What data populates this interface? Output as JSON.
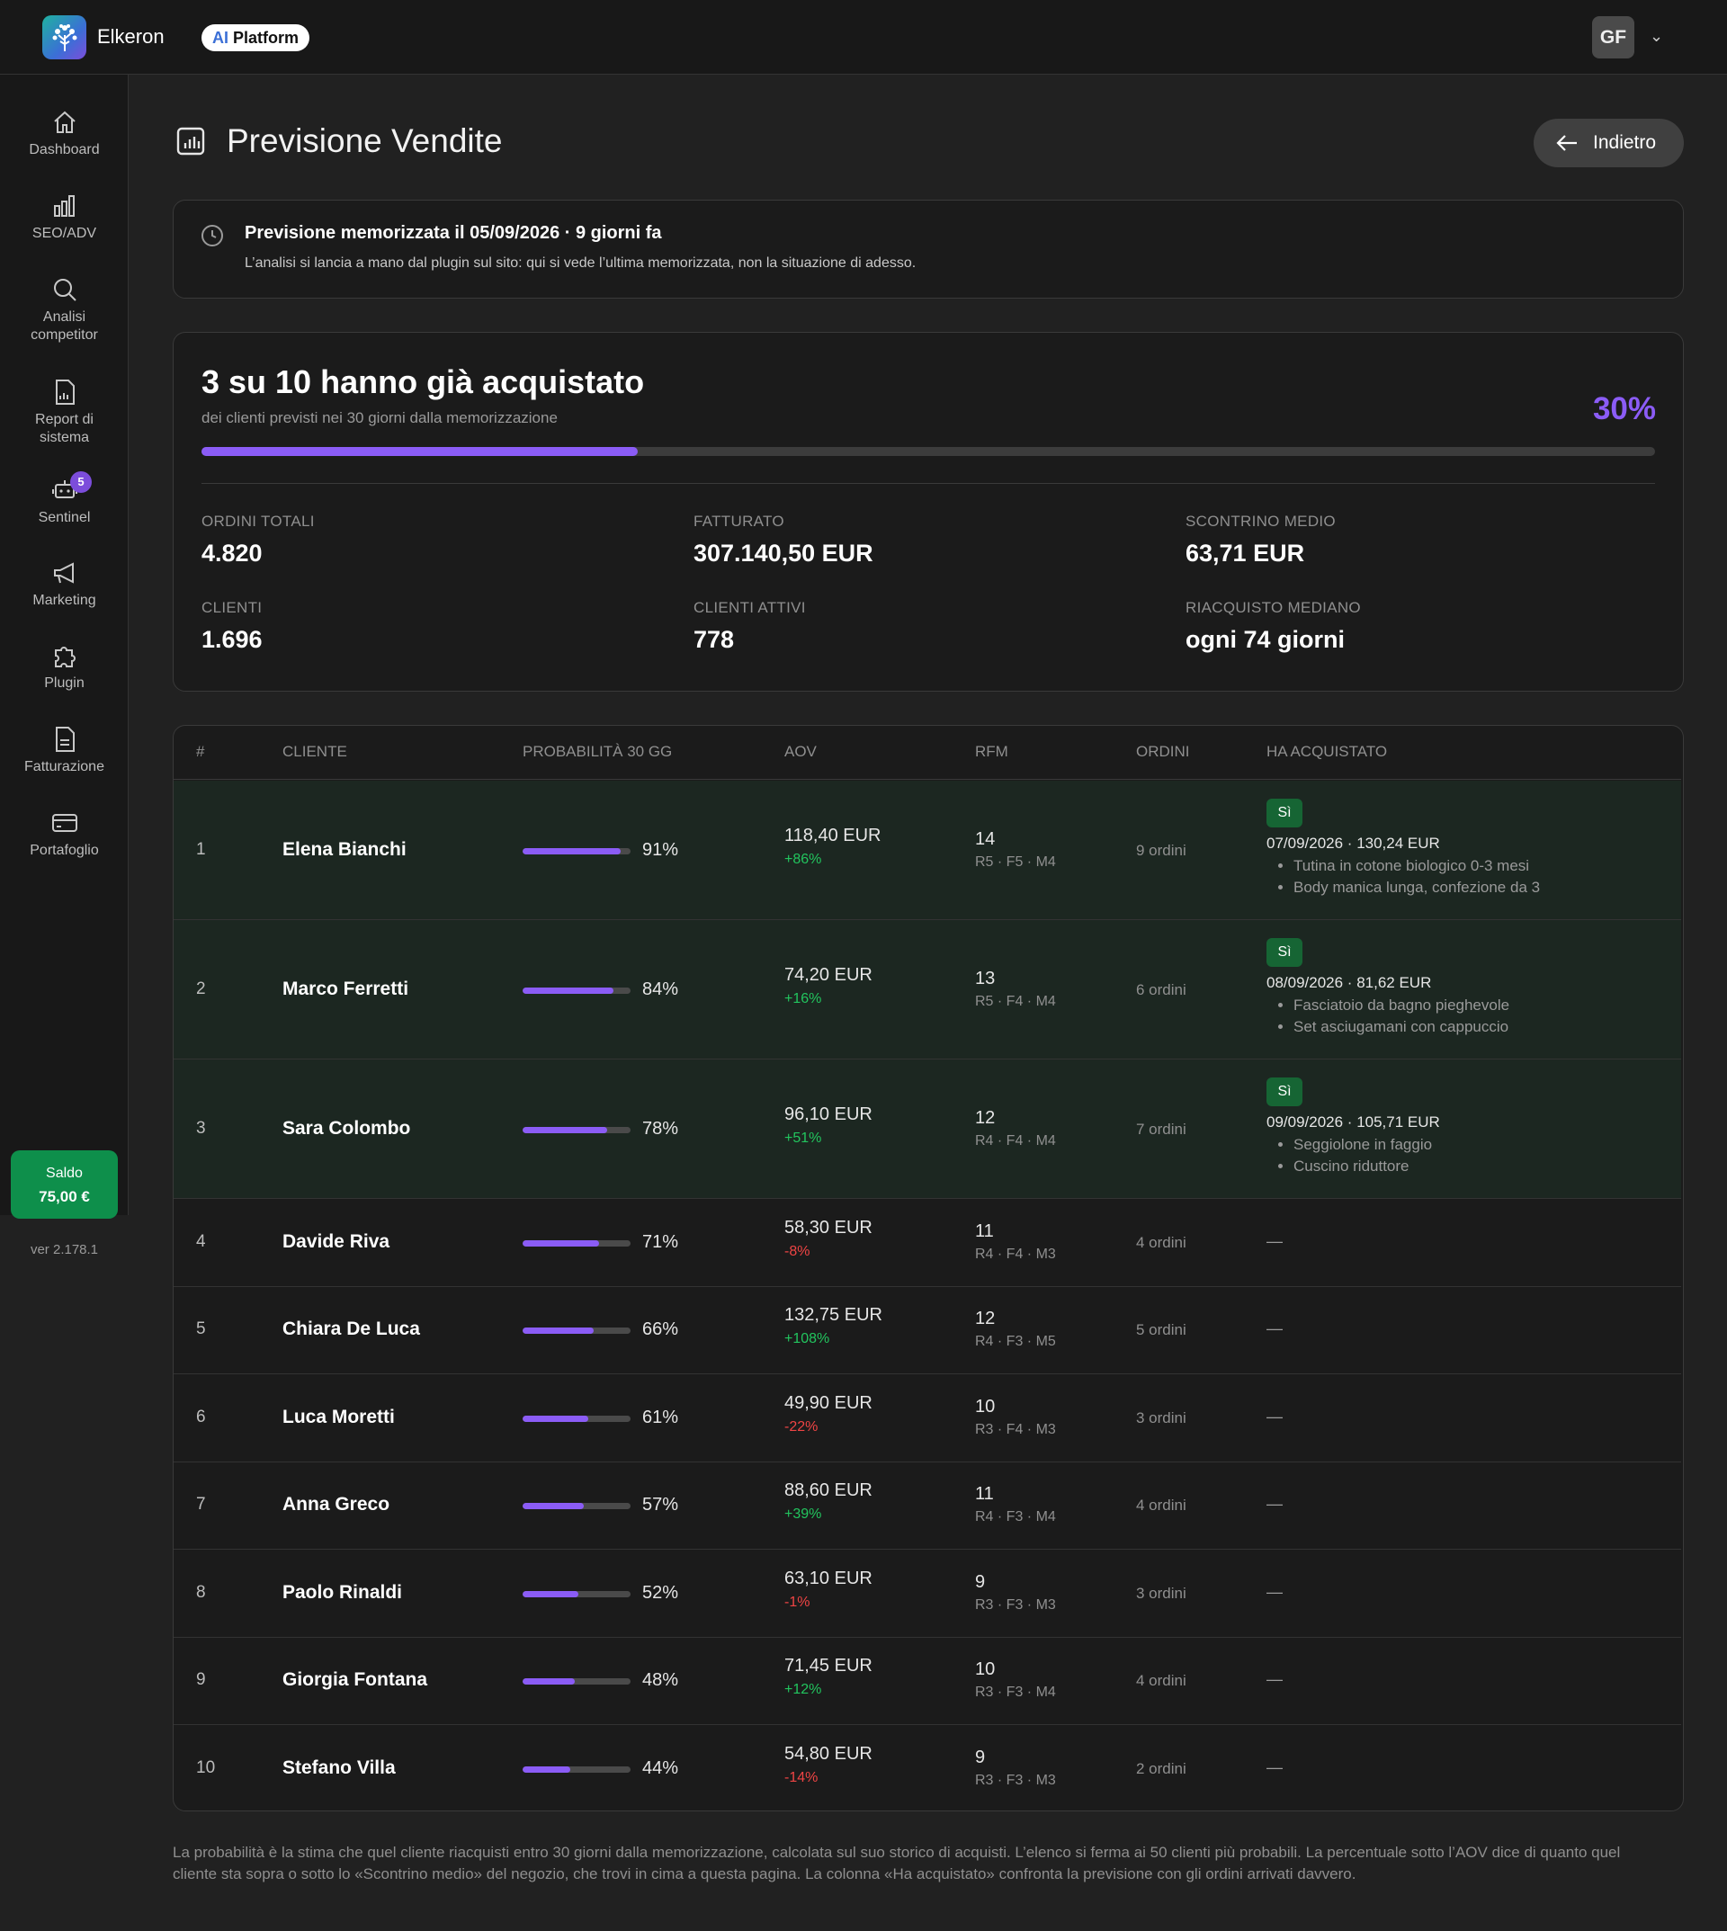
{
  "header": {
    "brand": "Elkeron",
    "ai_pill_ai": "AI",
    "ai_pill_text": "Platform",
    "avatar": "GF"
  },
  "sidebar": {
    "items": [
      {
        "label": "Dashboard",
        "icon": "home-icon"
      },
      {
        "label": "SEO/ADV",
        "icon": "bar-chart-icon"
      },
      {
        "label": "Analisi competitor",
        "icon": "search-icon"
      },
      {
        "label": "Report di sistema",
        "icon": "report-icon"
      },
      {
        "label": "Sentinel",
        "icon": "robot-icon",
        "badge": "5"
      },
      {
        "label": "Marketing",
        "icon": "megaphone-icon"
      },
      {
        "label": "Plugin",
        "icon": "puzzle-icon"
      },
      {
        "label": "Fatturazione",
        "icon": "invoice-icon"
      },
      {
        "label": "Portafoglio",
        "icon": "wallet-icon"
      }
    ],
    "saldo_label": "Saldo",
    "saldo_value": "75,00 €",
    "version": "ver 2.178.1"
  },
  "page": {
    "title": "Previsione Vendite",
    "back_label": "Indietro"
  },
  "info": {
    "title": "Previsione memorizzata il 05/09/2026 · 9 giorni fa",
    "text": "L’analisi si lancia a mano dal plugin sul sito: qui si vede l’ultima memorizzata, non la situazione di adesso."
  },
  "summary": {
    "headline": "3 su 10 hanno già acquistato",
    "sub": "dei clienti previsti nei 30 giorni dalla memorizzazione",
    "percent_label": "30%",
    "percent": 0.3,
    "stats": [
      {
        "label": "ORDINI TOTALI",
        "value": "4.820"
      },
      {
        "label": "FATTURATO",
        "value": "307.140,50 EUR"
      },
      {
        "label": "SCONTRINO MEDIO",
        "value": "63,71 EUR"
      },
      {
        "label": "CLIENTI",
        "value": "1.696"
      },
      {
        "label": "CLIENTI ATTIVI",
        "value": "778"
      },
      {
        "label": "RIACQUISTO MEDIANO",
        "value": "ogni 74 giorni"
      }
    ]
  },
  "table": {
    "headers": [
      "#",
      "CLIENTE",
      "PROBABILITÀ 30 GG",
      "AOV",
      "RFM",
      "ORDINI",
      "HA ACQUISTATO"
    ],
    "rows": [
      {
        "n": "1",
        "name": "Elena Bianchi",
        "prob": 0.91,
        "prob_label": "91%",
        "aov": "118,40 EUR",
        "delta": "+86%",
        "dir": "up",
        "rfm": "14",
        "rfm_s": "R5 · F5 · M4",
        "orders": "9 ordini",
        "bought": {
          "badge": "Sì",
          "detail": "07/09/2026 · 130,24 EUR",
          "items": [
            "Tutina in cotone biologico 0-3 mesi",
            "Body manica lunga, confezione da 3"
          ]
        }
      },
      {
        "n": "2",
        "name": "Marco Ferretti",
        "prob": 0.84,
        "prob_label": "84%",
        "aov": "74,20 EUR",
        "delta": "+16%",
        "dir": "up",
        "rfm": "13",
        "rfm_s": "R5 · F4 · M4",
        "orders": "6 ordini",
        "bought": {
          "badge": "Sì",
          "detail": "08/09/2026 · 81,62 EUR",
          "items": [
            "Fasciatoio da bagno pieghevole",
            "Set asciugamani con cappuccio"
          ]
        }
      },
      {
        "n": "3",
        "name": "Sara Colombo",
        "prob": 0.78,
        "prob_label": "78%",
        "aov": "96,10 EUR",
        "delta": "+51%",
        "dir": "up",
        "rfm": "12",
        "rfm_s": "R4 · F4 · M4",
        "orders": "7 ordini",
        "bought": {
          "badge": "Sì",
          "detail": "09/09/2026 · 105,71 EUR",
          "items": [
            "Seggiolone in faggio",
            "Cuscino riduttore"
          ]
        }
      },
      {
        "n": "4",
        "name": "Davide Riva",
        "prob": 0.71,
        "prob_label": "71%",
        "aov": "58,30 EUR",
        "delta": "-8%",
        "dir": "down",
        "rfm": "11",
        "rfm_s": "R4 · F4 · M3",
        "orders": "4 ordini",
        "none": "—"
      },
      {
        "n": "5",
        "name": "Chiara De Luca",
        "prob": 0.66,
        "prob_label": "66%",
        "aov": "132,75 EUR",
        "delta": "+108%",
        "dir": "up",
        "rfm": "12",
        "rfm_s": "R4 · F3 · M5",
        "orders": "5 ordini",
        "none": "—"
      },
      {
        "n": "6",
        "name": "Luca Moretti",
        "prob": 0.61,
        "prob_label": "61%",
        "aov": "49,90 EUR",
        "delta": "-22%",
        "dir": "down",
        "rfm": "10",
        "rfm_s": "R3 · F4 · M3",
        "orders": "3 ordini",
        "none": "—"
      },
      {
        "n": "7",
        "name": "Anna Greco",
        "prob": 0.57,
        "prob_label": "57%",
        "aov": "88,60 EUR",
        "delta": "+39%",
        "dir": "up",
        "rfm": "11",
        "rfm_s": "R4 · F3 · M4",
        "orders": "4 ordini",
        "none": "—"
      },
      {
        "n": "8",
        "name": "Paolo Rinaldi",
        "prob": 0.52,
        "prob_label": "52%",
        "aov": "63,10 EUR",
        "delta": "-1%",
        "dir": "down",
        "rfm": "9",
        "rfm_s": "R3 · F3 · M3",
        "orders": "3 ordini",
        "none": "—"
      },
      {
        "n": "9",
        "name": "Giorgia Fontana",
        "prob": 0.48,
        "prob_label": "48%",
        "aov": "71,45 EUR",
        "delta": "+12%",
        "dir": "up",
        "rfm": "10",
        "rfm_s": "R3 · F3 · M4",
        "orders": "4 ordini",
        "none": "—"
      },
      {
        "n": "10",
        "name": "Stefano Villa",
        "prob": 0.44,
        "prob_label": "44%",
        "aov": "54,80 EUR",
        "delta": "-14%",
        "dir": "down",
        "rfm": "9",
        "rfm_s": "R3 · F3 · M3",
        "orders": "2 ordini",
        "none": "—"
      }
    ]
  },
  "footnote": "La probabilità è la stima che quel cliente riacquisti entro 30 giorni dalla memorizzazione, calcolata sul suo storico di acquisti. L’elenco si ferma ai 50 clienti più probabili. La percentuale sotto l’AOV dice di quanto quel cliente sta sopra o sotto lo «Scontrino medio» del negozio, che trovi in cima a questa pagina. La colonna «Ha acquistato» confronta la previsione con gli ordini arrivati davvero.",
  "colors": {
    "accent": "#8b5cf6",
    "positive": "#22c55e",
    "negative": "#ef4444",
    "badge_green": "#166534",
    "saldo": "#0e8f4b"
  }
}
